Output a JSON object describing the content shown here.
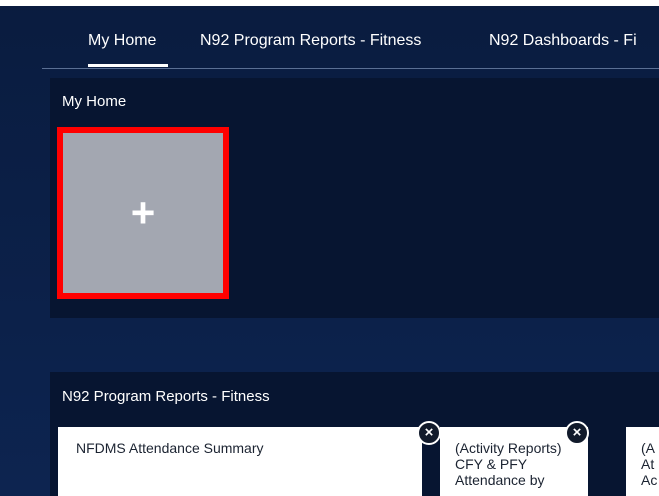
{
  "tabs": [
    {
      "label": "My Home",
      "active": true
    },
    {
      "label": "N92 Program Reports - Fitness",
      "active": false
    },
    {
      "label": "N92 Dashboards - Fi",
      "active": false
    }
  ],
  "home_section": {
    "title": "My Home",
    "add_tile": {
      "icon": "plus-icon",
      "symbol": "+"
    }
  },
  "reports_section": {
    "title": "N92 Program Reports - Fitness",
    "cards": [
      {
        "text": "NFDMS Attendance Summary"
      },
      {
        "text": "(Activity Reports)\nCFY & PFY\nAttendance by"
      },
      {
        "text": "(A\nAt\nAc"
      }
    ],
    "close_symbol": "×"
  },
  "colors": {
    "background": "#0b1f46",
    "panel": "#071531",
    "highlight_border": "#ff0000",
    "tile": "#a3a7b1",
    "text": "#ffffff"
  }
}
